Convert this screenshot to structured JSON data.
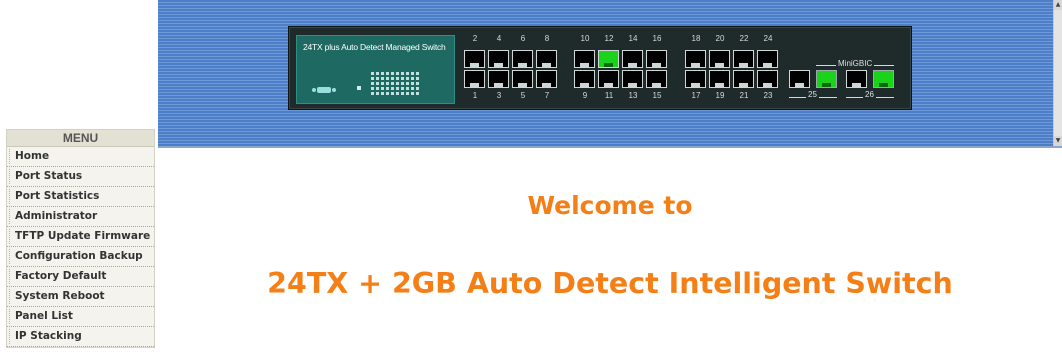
{
  "panel": {
    "title": "24TX plus Auto Detect Managed Switch",
    "top_port_labels": [
      "2",
      "4",
      "6",
      "8",
      "10",
      "12",
      "14",
      "16",
      "18",
      "20",
      "22",
      "24"
    ],
    "bottom_port_labels": [
      "1",
      "3",
      "5",
      "7",
      "9",
      "11",
      "13",
      "15",
      "17",
      "19",
      "21",
      "23"
    ],
    "active_ports": [
      "12"
    ],
    "port25_label": "25",
    "port26_label": "26",
    "minigbic_label": "MiniGBIC",
    "active_color": "#1bd31b"
  },
  "menu": {
    "title": "MENU",
    "items": [
      {
        "label": "Home"
      },
      {
        "label": "Port Status"
      },
      {
        "label": "Port Statistics"
      },
      {
        "label": "Administrator"
      },
      {
        "label": "TFTP Update Firmware"
      },
      {
        "label": "Configuration Backup"
      },
      {
        "label": "Factory Default"
      },
      {
        "label": "System Reboot"
      },
      {
        "label": "Panel List"
      },
      {
        "label": "IP Stacking"
      }
    ]
  },
  "main": {
    "welcome_line1": "Welcome to",
    "welcome_line2": "24TX + 2GB Auto Detect Intelligent Switch",
    "accent_color": "#f57f17"
  }
}
